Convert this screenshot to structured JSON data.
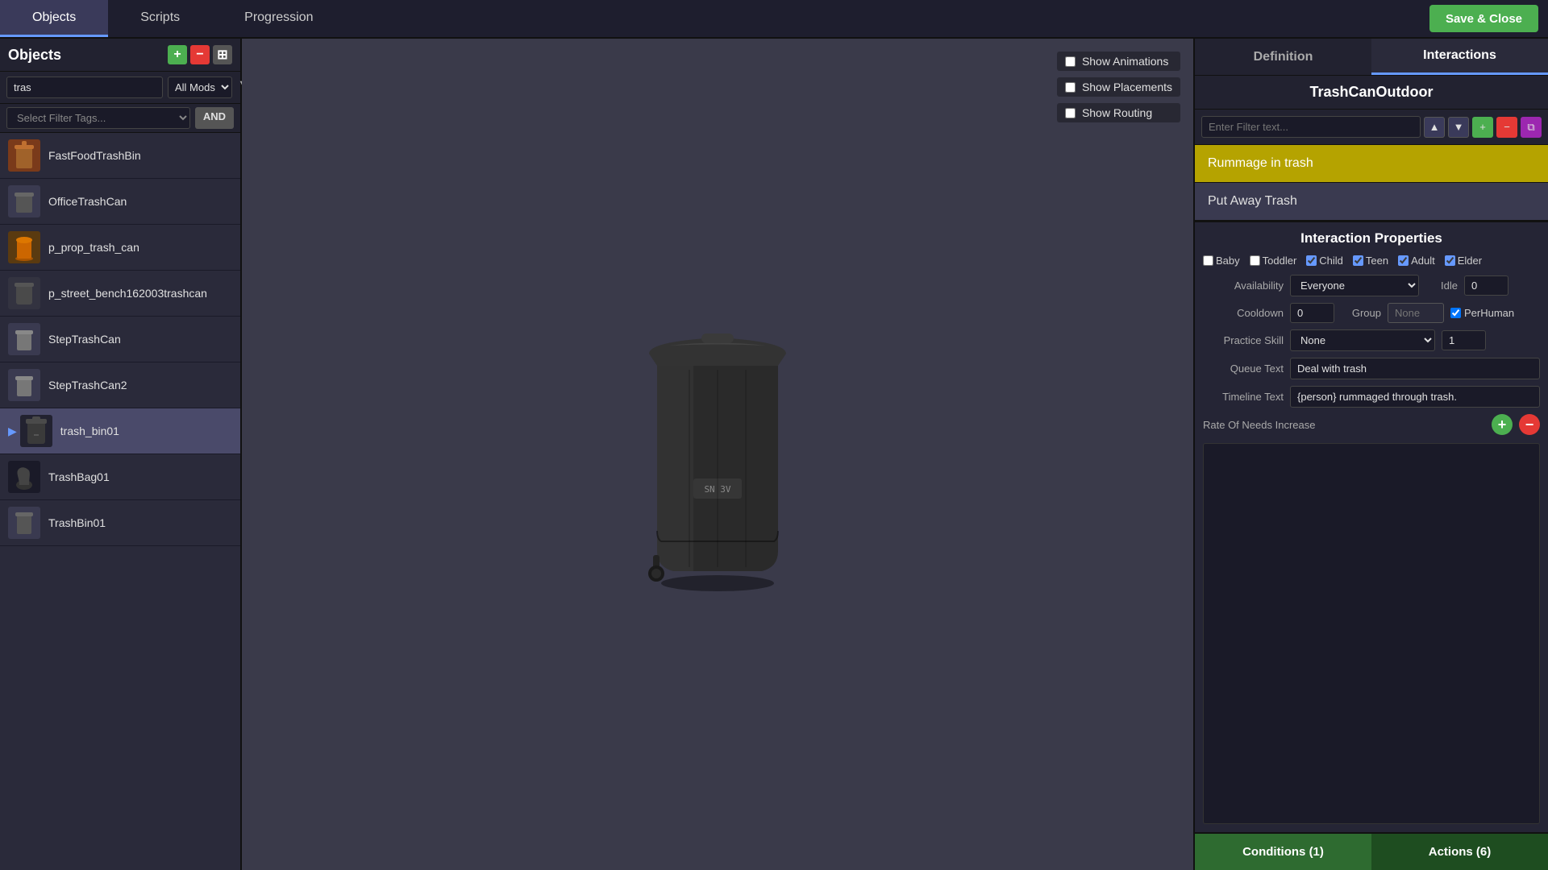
{
  "topbar": {
    "tabs": [
      {
        "label": "Objects",
        "active": true
      },
      {
        "label": "Scripts",
        "active": false
      },
      {
        "label": "Progression",
        "active": false
      }
    ],
    "save_close_label": "Save & Close"
  },
  "left_panel": {
    "title": "Objects",
    "add_icon": "+",
    "remove_icon": "−",
    "grid_icon": "⊞",
    "search_placeholder": "tras",
    "mods_label": "All Mods",
    "filter_tags_placeholder": "Select Filter Tags...",
    "and_label": "AND",
    "objects": [
      {
        "name": "FastFoodTrashBin",
        "icon": "🗑",
        "color": "#a0522d"
      },
      {
        "name": "OfficeTrashCan",
        "icon": "🗑",
        "color": "#555"
      },
      {
        "name": "p_prop_trash_can",
        "icon": "🗑",
        "color": "#cc6600"
      },
      {
        "name": "p_street_bench162003trashcan",
        "icon": "🗑",
        "color": "#4a4a4a"
      },
      {
        "name": "StepTrashCan",
        "icon": "🗑",
        "color": "#888"
      },
      {
        "name": "StepTrashCan2",
        "icon": "🗑",
        "color": "#888"
      },
      {
        "name": "trash_bin01",
        "icon": "🗑",
        "color": "#3a3a3a",
        "selected": true
      },
      {
        "name": "TrashBag01",
        "icon": "🛍",
        "color": "#222"
      },
      {
        "name": "TrashBin01",
        "icon": "🗑",
        "color": "#555"
      }
    ]
  },
  "viewport": {
    "checkboxes": [
      {
        "label": "Show Animations",
        "checked": false
      },
      {
        "label": "Show Placements",
        "checked": false
      },
      {
        "label": "Show Routing",
        "checked": false
      }
    ]
  },
  "right_panel": {
    "def_tab": "Definition",
    "int_tab": "Interactions",
    "int_tab_active": true,
    "object_type_title": "TrashCanOutdoor",
    "filter_placeholder": "Enter Filter text...",
    "interactions": [
      {
        "label": "Rummage in trash",
        "highlighted": true
      },
      {
        "label": "Put Away Trash",
        "highlighted": false
      }
    ],
    "interaction_properties": {
      "title": "Interaction Properties",
      "age_checks": [
        {
          "label": "Baby",
          "checked": false
        },
        {
          "label": "Toddler",
          "checked": false
        },
        {
          "label": "Child",
          "checked": true
        },
        {
          "label": "Teen",
          "checked": true
        },
        {
          "label": "Adult",
          "checked": true
        },
        {
          "label": "Elder",
          "checked": true
        }
      ],
      "availability_label": "Availability",
      "availability_value": "Everyone",
      "idle_label": "Idle",
      "idle_value": "0",
      "cooldown_label": "Cooldown",
      "cooldown_value": "0",
      "group_label": "Group",
      "group_placeholder": "None",
      "per_human_label": "PerHuman",
      "per_human_checked": true,
      "practice_skill_label": "Practice Skill",
      "practice_skill_value": "None",
      "practice_skill_num": "1",
      "queue_text_label": "Queue Text",
      "queue_text_value": "Deal with trash",
      "timeline_text_label": "Timeline Text",
      "timeline_text_value": "{person} rummaged through trash.",
      "rate_of_needs_label": "Rate Of Needs Increase",
      "rate_plus": "+",
      "rate_minus": "−"
    },
    "conditions_btn": "Conditions (1)",
    "actions_btn": "Actions (6)"
  }
}
